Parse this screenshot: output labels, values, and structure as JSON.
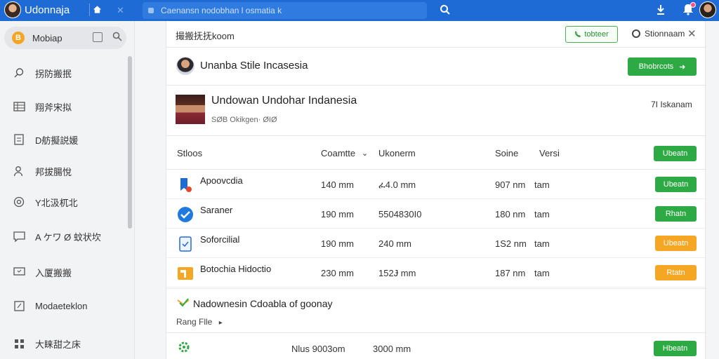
{
  "topbar": {
    "app_title": "Udonnaja",
    "search_placeholder": "Caenansn nodobhan l osmatia k"
  },
  "sidebar": {
    "header_label": "Mobiap",
    "header_badge": "B",
    "items": [
      {
        "label": "拐防搬抿",
        "icon": "search-icon"
      },
      {
        "label": "翔斧宋拟",
        "icon": "table-icon"
      },
      {
        "label": "D舫擬説媛",
        "icon": "document-icon"
      },
      {
        "label": "邦拔腸悅",
        "icon": "user-icon"
      },
      {
        "label": "Y北汲杌北",
        "icon": "settings-icon"
      },
      {
        "label": "A ケワ Ø 蚊状坎",
        "icon": "chat-icon"
      },
      {
        "label": "入厦搬搬",
        "icon": "monitor-icon"
      },
      {
        "label": "Modaeteklon",
        "icon": "edit-icon"
      },
      {
        "label": "大睐甜之床",
        "icon": "grid-icon"
      }
    ]
  },
  "main": {
    "title": "撮搬抚抚koom",
    "header_button": "tobteer",
    "status": "Stionnaam",
    "profile": {
      "name": "Unanba Stile Incasesia",
      "button": "Bhobrcots"
    },
    "org": {
      "name": "Undowan Undohar Indanesia",
      "sub": "SØB Okikgen· ØIØ",
      "meta": "7I Iskanam"
    },
    "table": {
      "headers": [
        "Stloos",
        "Coamtte",
        "Ukonerm",
        "Soine",
        "Versi"
      ],
      "header_button": "Ubeatn",
      "rows": [
        {
          "name": "Apoovcdia",
          "c1": "140 mm",
          "c2": "ፈ4.0 mm",
          "c3": "907 nm",
          "c4": "tam",
          "action": "Ubeatn",
          "color": "#2eaa44",
          "icon": "bookmark-icon"
        },
        {
          "name": "Saraner",
          "c1": "190 mm",
          "c2": "5504830I0",
          "c3": "180 nm",
          "c4": "tam",
          "action": "Rhatn",
          "color": "#2eaa44",
          "icon": "cloud-icon"
        },
        {
          "name": "Soforcilial",
          "c1": "190 mm",
          "c2": "240 mm",
          "c3": "1S2 nm",
          "c4": "tam",
          "action": "Ubeatn",
          "color": "#f5a623",
          "icon": "file-icon"
        },
        {
          "name": "Botochia Hidoctio",
          "c1": "230 mm",
          "c2": "152Ɉ mm",
          "c3": "187 nm",
          "c4": "tam",
          "action": "Rtatn",
          "color": "#f5a623",
          "icon": "tools-icon"
        }
      ]
    },
    "section2": {
      "title": "Nadownesin Cdoabla of goonay",
      "link": "Rang Flle"
    },
    "last_row": {
      "c1": "Nlus  9003om",
      "c2": "3000 mm",
      "button": "Hbeatn"
    }
  }
}
